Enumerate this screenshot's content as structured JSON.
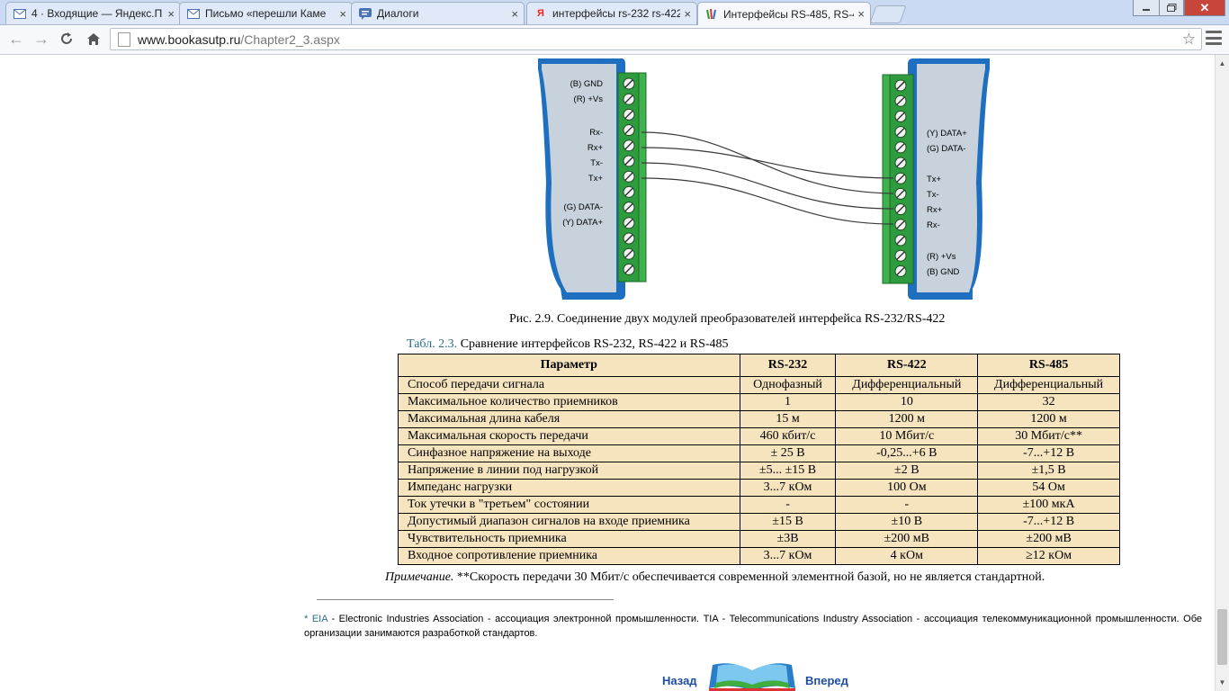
{
  "browser": {
    "tabs": [
      {
        "title": "4 · Входящие — Яндекс.П",
        "icon": "mail-icon",
        "active": false
      },
      {
        "title": "Письмо «перешли Каме",
        "icon": "mail-icon",
        "active": false
      },
      {
        "title": "Диалоги",
        "icon": "chat-icon",
        "active": false
      },
      {
        "title": "интерфейсы rs-232 rs-422",
        "icon": "yandex-icon",
        "active": false
      },
      {
        "title": "Интерфейсы RS-485, RS-4",
        "icon": "site-icon",
        "active": true
      }
    ],
    "url_host": "www.bookasutp.ru",
    "url_path": "/Chapter2_3.aspx",
    "accent": "#c9daf2"
  },
  "figure": {
    "left_module_labels": [
      "(B) GND",
      "(R) +Vs",
      "Rx-",
      "Rx+",
      "Tx-",
      "Tx+",
      "(G) DATA-",
      "(Y) DATA+"
    ],
    "right_module_labels": [
      "(Y) DATA+",
      "(G) DATA-",
      "Tx+",
      "Tx-",
      "Rx+",
      "Rx-",
      "(R) +Vs",
      "(B) GND"
    ],
    "caption": "Рис. 2.9. Соединение двух модулей преобразователей интерфейса RS-232/RS-422"
  },
  "table": {
    "caption_label": "Табл. 2.3.",
    "caption_text": "Сравнение интерфейсов RS-232, RS-422 и RS-485",
    "headers": [
      "Параметр",
      "RS-232",
      "RS-422",
      "RS-485"
    ],
    "rows": [
      [
        "Способ передачи сигнала",
        "Однофазный",
        "Дифференциальный",
        "Дифференциальный"
      ],
      [
        "Максимальное количество приемников",
        "1",
        "10",
        "32"
      ],
      [
        "Максимальная длина кабеля",
        "15 м",
        "1200 м",
        "1200 м"
      ],
      [
        "Максимальная скорость передачи",
        "460 кбит/с",
        "10 Мбит/с",
        "30 Мбит/с**"
      ],
      [
        "Синфазное напряжение на выходе",
        "± 25 В",
        "-0,25...+6 В",
        "-7...+12 В"
      ],
      [
        "Напряжение в линии под нагрузкой",
        "±5... ±15 В",
        "±2 В",
        "±1,5 В"
      ],
      [
        "Импеданс нагрузки",
        "3...7 кОм",
        "100 Ом",
        "54 Ом"
      ],
      [
        "Ток утечки в \"третьем\" состоянии",
        "-",
        "-",
        "±100 мкА"
      ],
      [
        "Допустимый диапазон сигналов на входе приемника",
        "±15 В",
        "±10 В",
        "-7...+12 В"
      ],
      [
        "Чувствительность приемника",
        "±3В",
        "±200 мВ",
        "±200 мВ"
      ],
      [
        "Входное сопротивление приемника",
        "3...7 кОм",
        "4 кОм",
        "≥12 кОм"
      ]
    ],
    "bg_color": "#f6e4bf"
  },
  "note": {
    "label": "Примечание.",
    "text": " **Скорость передачи 30 Мбит/с обеспечивается современной элементной базой, но не является стандартной."
  },
  "footnote": {
    "mark": "* EIA",
    "text": " - Electronic Industries Association - ассоциация электронной промышленности. TIA - Telecommunications Industry Association - ассоциация телекоммуникационной промышленности. Обе организации занимаются разработкой стандартов."
  },
  "pager": {
    "prev": "Назад",
    "next": "Вперед"
  }
}
